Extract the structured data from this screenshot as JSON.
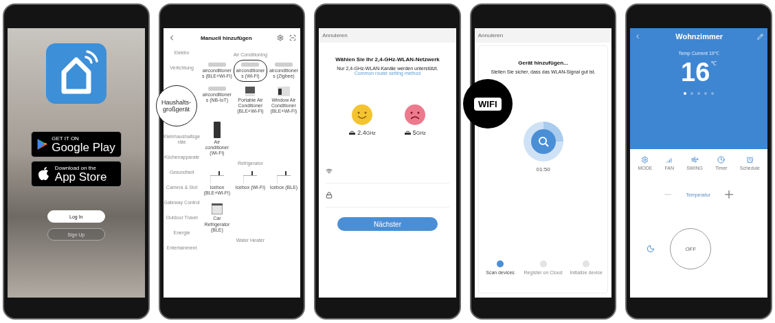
{
  "welcome_screen": {
    "store_badges": [
      {
        "kind": "google",
        "small": "GET IT ON",
        "large": "Google Play"
      },
      {
        "kind": "apple",
        "small": "Download on the",
        "large": "App Store"
      }
    ],
    "login_button": "Log In",
    "signup_button": "Sign Up"
  },
  "manual_add_screen": {
    "title": "Manuell hinzufügen",
    "callout": "Haushalts-großgerät",
    "categories": [
      "Elektro",
      "Verlichtung",
      "Kleinhaushaltsgeräte",
      "Küchenapparate",
      "Gesundheit",
      "Camera & Slot",
      "Gateway Control",
      "Outdoor Travel",
      "Energie",
      "Entertainment"
    ],
    "sections": [
      {
        "title": "Air Conditioning",
        "devices": [
          {
            "kind": "wall-unit",
            "label": "airconditioners (BLE+Wi-Fi)",
            "highlighted": false
          },
          {
            "kind": "wall-unit",
            "label": "airconditioners (Wi-Fi)",
            "highlighted": true
          },
          {
            "kind": "wall-unit",
            "label": "airconditioners (Zigbee)",
            "highlighted": false
          },
          {
            "kind": "wall-unit",
            "label": "airconditioners (NB-IoT)",
            "highlighted": false
          },
          {
            "kind": "portable",
            "label": "Portable Air Conditioner (BLE+Wi-Fi)",
            "highlighted": false
          },
          {
            "kind": "window",
            "label": "Window Air Conditioner (BLE+Wi-Fi)",
            "highlighted": false
          },
          {
            "kind": "tower",
            "label": "Air conditioner (Wi-Fi)",
            "highlighted": false
          }
        ]
      },
      {
        "title": "Refrigerator",
        "devices": [
          {
            "kind": "icebox",
            "label": "Icebox (BLE+Wi-Fi)",
            "highlighted": false
          },
          {
            "kind": "icebox",
            "label": "Icebox (Wi-Fi)",
            "highlighted": false
          },
          {
            "kind": "icebox",
            "label": "Icebox (BLE)",
            "highlighted": false
          },
          {
            "kind": "car-fridge",
            "label": "Car Refrigerator (BLE)",
            "highlighted": false
          }
        ]
      },
      {
        "title": "Water Heater"
      }
    ]
  },
  "wifi_screen": {
    "cancel": "Annuleren",
    "title": "Wählen Sie Ihr 2,4-GHz-WLAN-Netzwerk",
    "subtitle": "Nur 2,4-GHz-WLAN-Kanäle werden unterstützt.",
    "link": "Common router setting method",
    "bands": [
      {
        "kind": "happy",
        "value": "2.4",
        "unit": "GHz"
      },
      {
        "kind": "sad",
        "value": "5",
        "unit": "GHz"
      }
    ],
    "fields": [
      {
        "kind": "network"
      },
      {
        "kind": "password"
      }
    ],
    "next_button": "Nächster"
  },
  "pairing_screen": {
    "cancel": "Annuleren",
    "badge": "WIFI",
    "title": "Gerät hinzufügen...",
    "subtitle": "Stellen Sie sicher, dass das WLAN-Signal gut ist.",
    "timer": "01:50",
    "steps": [
      {
        "label": "Scan devices",
        "selected": true
      },
      {
        "label": "Register on Cloud",
        "selected": false
      },
      {
        "label": "Initialize device",
        "selected": false
      }
    ]
  },
  "control_screen": {
    "title": "Wohnzimmer",
    "current": "Temp Current 19℃",
    "temperature": "16",
    "unit": "℃",
    "pages": [
      {
        "selected": true
      },
      {
        "selected": false
      },
      {
        "selected": false
      },
      {
        "selected": false
      },
      {
        "selected": false
      }
    ],
    "functions": [
      {
        "kind": "mode",
        "label": "MODE"
      },
      {
        "kind": "fan",
        "label": "FAN"
      },
      {
        "kind": "swing",
        "label": "SWING"
      },
      {
        "kind": "timer",
        "label": "Timer"
      },
      {
        "kind": "alarm",
        "label": "Schedule"
      }
    ],
    "temperature_label": "Temperatur",
    "power_button": "OFF"
  }
}
